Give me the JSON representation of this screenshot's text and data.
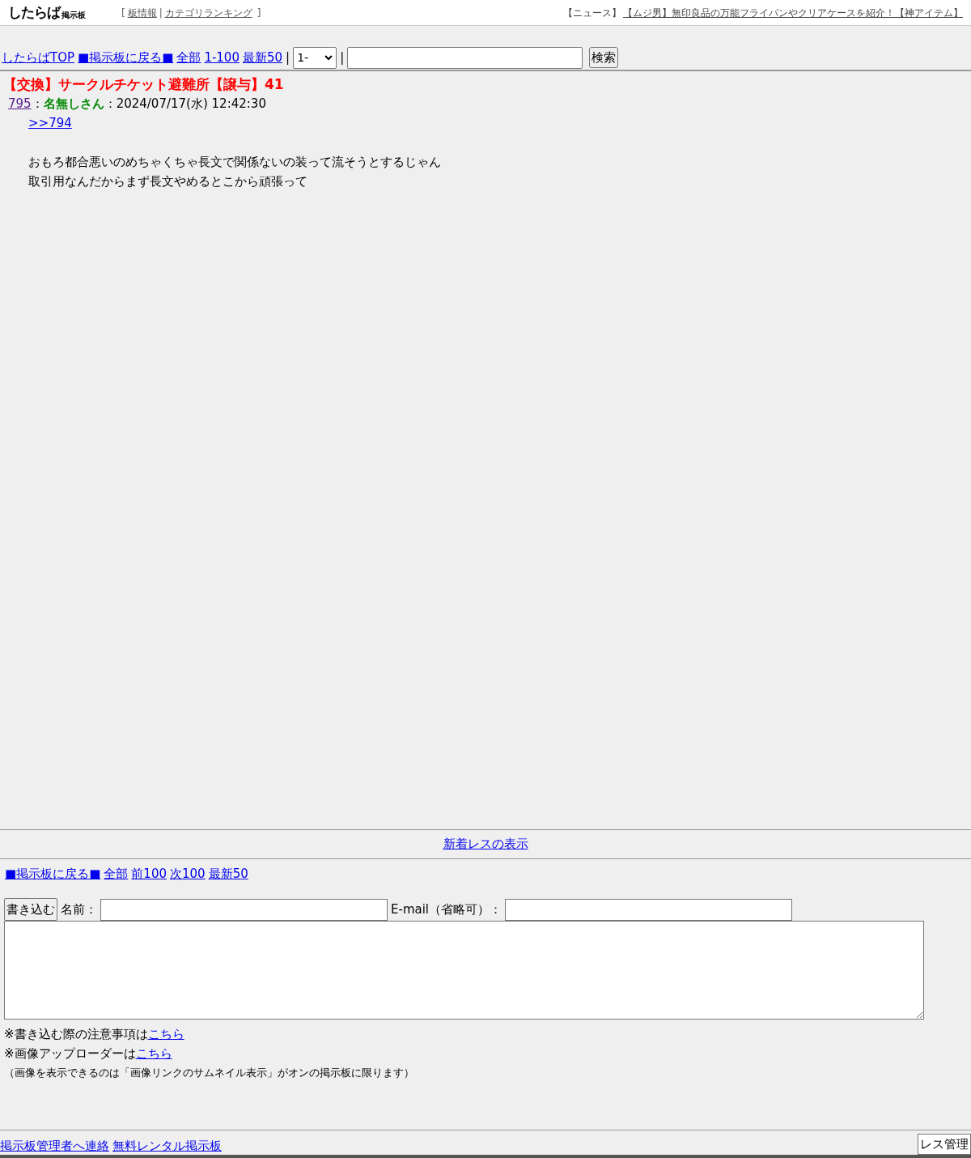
{
  "header": {
    "logo": {
      "main": "したらば",
      "sub": "掲示板"
    },
    "links": [
      {
        "open": "[",
        "text": "板情報"
      },
      {
        "open": "|",
        "text": "カテゴリランキング"
      }
    ],
    "close": "]",
    "news": {
      "label": "【ニュース】",
      "link": "【ムジ男】無印良品の万能フライパンやクリアケースを紹介！【神アイテム】"
    }
  },
  "nav": {
    "links": [
      {
        "text": "したらばTOP"
      },
      {
        "text": "■掲示板に戻る■"
      },
      {
        "text": "全部"
      },
      {
        "text": "1-100"
      },
      {
        "text": "最新50"
      }
    ],
    "separator": "|",
    "select": {
      "value": "1-"
    },
    "search_button": "検索"
  },
  "thread": {
    "title": "【交換】サークルチケット避難所【譲与】41",
    "post": {
      "number": "795",
      "visited": true,
      "separator": "：",
      "name": "名無しさん",
      "date": "2024/07/17(水) 12:42:30",
      "body": [
        {
          "kind": "anchor",
          "text": ">>794"
        },
        {
          "kind": "blank"
        },
        {
          "kind": "line",
          "text": "おもろ都合悪いのめちゃくちゃ長文で関係ないの装って流そうとするじゃん"
        },
        {
          "kind": "line",
          "text": "取引用なんだからまず長文やめるとこから頑張って"
        }
      ]
    }
  },
  "new_posts_link": "新着レスの表示",
  "bottom_nav": [
    "■掲示板に戻る■",
    "全部",
    "前100",
    "次100",
    "最新50"
  ],
  "form": {
    "submit": "書き込む",
    "name_label": "名前：",
    "email_label": "E-mail（省略可）：",
    "notes": [
      {
        "text": "※書き込む際の注意事項は",
        "link": "こちら"
      },
      {
        "text": "※画像アップローダーは",
        "link": "こちら"
      }
    ],
    "small_note": "（画像を表示できるのは「画像リンクのサムネイル表示」がオンの掲示板に限ります）"
  },
  "footer": {
    "links": [
      "掲示板管理者へ連絡",
      "無料レンタル掲示板"
    ],
    "manage_button": "レス管理"
  }
}
